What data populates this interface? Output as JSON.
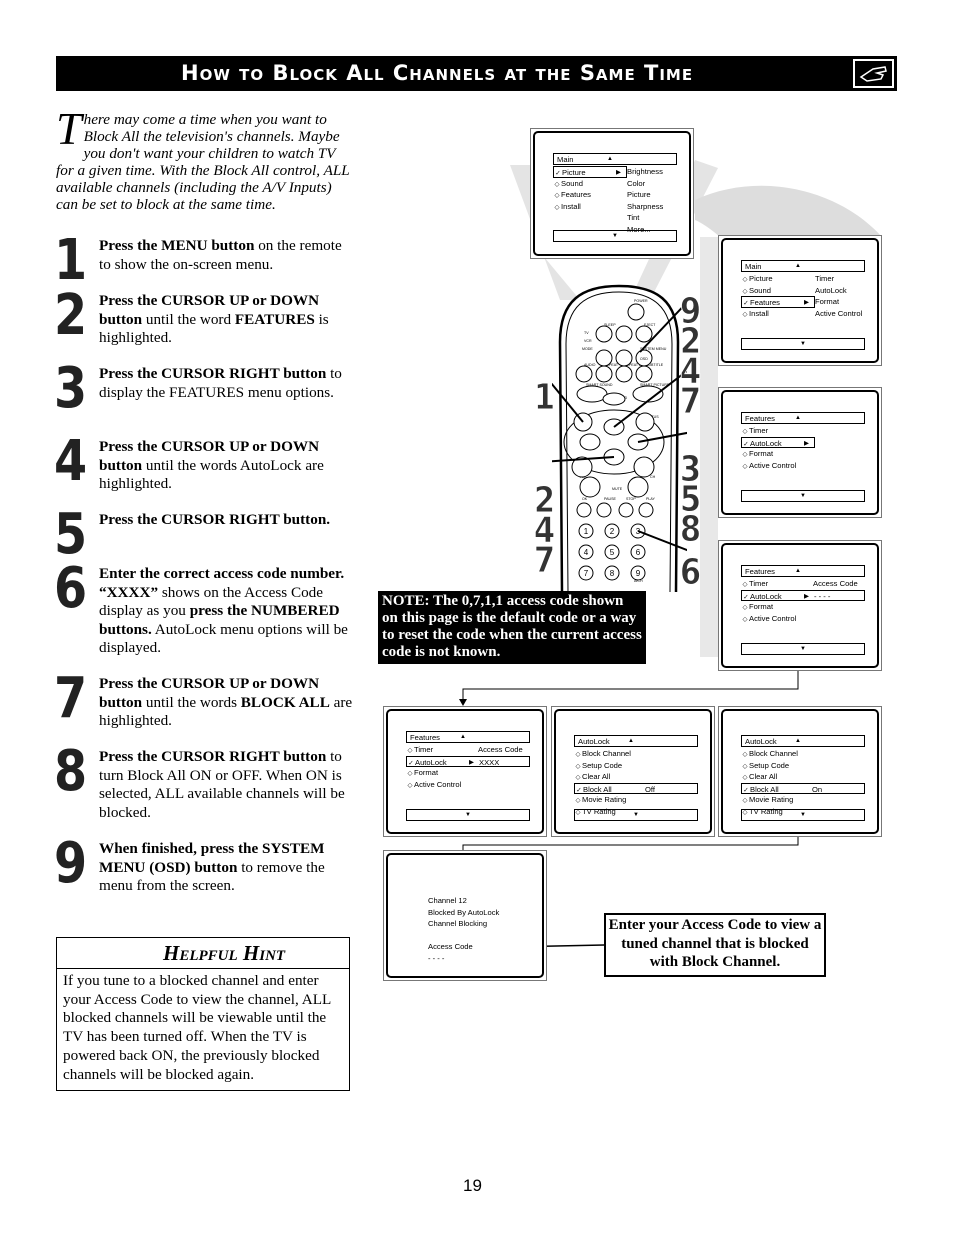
{
  "header": {
    "title": "How to Block All Channels at the Same Time",
    "icon": "hand-pointing-icon"
  },
  "intro": {
    "drop": "T",
    "text": "here may come a time when you want to Block All the television's channels. Maybe you don't want your children to watch TV for a given time. With the Block All control, ALL available channels (including the A/V Inputs) can be set to block at the same time."
  },
  "steps": [
    {
      "num": "1",
      "bold": "Press the MENU button",
      "rest": " on the remote to show the on-screen menu."
    },
    {
      "num": "2",
      "bold": "Press the CURSOR UP or DOWN button",
      "rest": " until the word ",
      "bold2": "FEATURES",
      "rest2": " is highlighted."
    },
    {
      "num": "3",
      "bold": "Press the CURSOR RIGHT button",
      "rest": " to display the FEATURES menu options."
    },
    {
      "num": "4",
      "bold": "Press the CURSOR UP or DOWN button",
      "rest": " until the words AutoLock are highlighted."
    },
    {
      "num": "5",
      "bold": "Press the CURSOR RIGHT button.",
      "rest": ""
    },
    {
      "num": "6",
      "bold": "Enter the correct access code number. “XXXX”",
      "rest": " shows on the Access Code display as you ",
      "bold2": "press the NUMBERED buttons.",
      "rest2": " AutoLock menu options will be displayed."
    },
    {
      "num": "7",
      "bold": "Press the CURSOR UP or DOWN button",
      "rest": " until the words ",
      "bold2": "BLOCK ALL",
      "rest2": " are highlighted."
    },
    {
      "num": "8",
      "bold": "Press the CURSOR RIGHT button",
      "rest": " to turn Block All ON or OFF. When ON is selected, ALL available channels will be blocked."
    },
    {
      "num": "9",
      "bold": "When finished, press the SYSTEM MENU (OSD) button",
      "rest": " to remove the menu from the screen."
    }
  ],
  "hint": {
    "title": "Helpful Hint",
    "body": "If you tune to a blocked channel and enter your Access Code to view the channel, ALL blocked channels will be viewable until the TV has been turned off. When the TV is powered back ON, the previously blocked channels will be blocked again."
  },
  "note": "NOTE: The 0,7,1,1 access code shown on this page is the default code or a way to reset the code when the current access code is not known.",
  "callout": "Enter your Access Code to view a tuned channel that is blocked with Block Channel.",
  "page_number": "19",
  "remote": {
    "labels": [
      "POWER",
      "SLEEP",
      "EJECT",
      "TV",
      "VCR",
      "MODE",
      "SYSTEM MENU",
      "AUDIO",
      "REPEAT",
      "REPEAT A-B",
      "SUBTITLE",
      "SMART SOUND",
      "SMART PICTURE",
      "TV/DVD",
      "MENU",
      "STATUS",
      "VOL",
      "MUTE",
      "CH",
      "OK",
      "PAUSE",
      "STOP",
      "PLAY",
      "A/CH"
    ],
    "osd": "OSD",
    "digits": [
      "1",
      "2",
      "3",
      "4",
      "5",
      "6",
      "7",
      "8",
      "9"
    ]
  },
  "step_callouts": {
    "left_top": [
      "1"
    ],
    "right_top": [
      "9",
      "2",
      "4",
      "7"
    ],
    "right_mid": [
      "3",
      "5",
      "8"
    ],
    "right_bot": [
      "6"
    ],
    "left_bot": [
      "2",
      "4",
      "7"
    ]
  },
  "screens": [
    {
      "id": "s1",
      "head": "Main",
      "rows": [
        {
          "mk": "✓",
          "label": "Picture",
          "sel": true,
          "ar": true
        },
        {
          "mk": "◇",
          "label": "Sound"
        },
        {
          "mk": "◇",
          "label": "Features"
        },
        {
          "mk": "◇",
          "label": "Install"
        }
      ],
      "side": [
        "Brightness",
        "Color",
        "Picture",
        "Sharpness",
        "Tint",
        "More..."
      ]
    },
    {
      "id": "s2",
      "head": "Main",
      "rows": [
        {
          "mk": "◇",
          "label": "Picture"
        },
        {
          "mk": "◇",
          "label": "Sound"
        },
        {
          "mk": "✓",
          "label": "Features",
          "sel": true,
          "ar": true
        },
        {
          "mk": "◇",
          "label": "Install"
        }
      ],
      "side": [
        "Timer",
        "AutoLock",
        "Format",
        "Active Control"
      ]
    },
    {
      "id": "s3",
      "head": "Features",
      "rows": [
        {
          "mk": "◇",
          "label": "Timer"
        },
        {
          "mk": "✓",
          "label": "AutoLock",
          "sel": true,
          "ar": true
        },
        {
          "mk": "◇",
          "label": "Format"
        },
        {
          "mk": "◇",
          "label": "Active Control"
        }
      ]
    },
    {
      "id": "s4",
      "head": "Features",
      "rows": [
        {
          "mk": "◇",
          "label": "Timer",
          "val": "Access Code"
        },
        {
          "mk": "✓",
          "label": "AutoLock",
          "sel": true,
          "wide": true,
          "ar": true,
          "val": "- - - -"
        },
        {
          "mk": "◇",
          "label": "Format"
        },
        {
          "mk": "◇",
          "label": "Active Control"
        }
      ]
    },
    {
      "id": "s5",
      "head": "Features",
      "rows": [
        {
          "mk": "◇",
          "label": "Timer",
          "val": "Access Code"
        },
        {
          "mk": "✓",
          "label": "AutoLock",
          "sel": true,
          "wide": true,
          "ar": true,
          "val": "XXXX"
        },
        {
          "mk": "◇",
          "label": "Format"
        },
        {
          "mk": "◇",
          "label": "Active Control"
        }
      ]
    },
    {
      "id": "s6",
      "head": "AutoLock",
      "rows": [
        {
          "mk": "◇",
          "label": "Block Channel"
        },
        {
          "mk": "◇",
          "label": "Setup Code"
        },
        {
          "mk": "◇",
          "label": "Clear All"
        },
        {
          "mk": "✓",
          "label": "Block All",
          "sel": true,
          "wide": true,
          "val": "Off"
        },
        {
          "mk": "◇",
          "label": "Movie Rating"
        },
        {
          "mk": "◇",
          "label": "TV Rating"
        }
      ]
    },
    {
      "id": "s7",
      "head": "AutoLock",
      "rows": [
        {
          "mk": "◇",
          "label": "Block Channel"
        },
        {
          "mk": "◇",
          "label": "Setup Code"
        },
        {
          "mk": "◇",
          "label": "Clear All"
        },
        {
          "mk": "✓",
          "label": "Block All",
          "sel": true,
          "wide": true,
          "val": "On"
        },
        {
          "mk": "◇",
          "label": "Movie Rating"
        },
        {
          "mk": "◇",
          "label": "TV Rating"
        }
      ]
    }
  ],
  "blocked_screen": {
    "lines": [
      "Channel 12",
      "Blocked By AutoLock",
      "Channel Blocking",
      "",
      "Access Code",
      "- - - -"
    ]
  }
}
